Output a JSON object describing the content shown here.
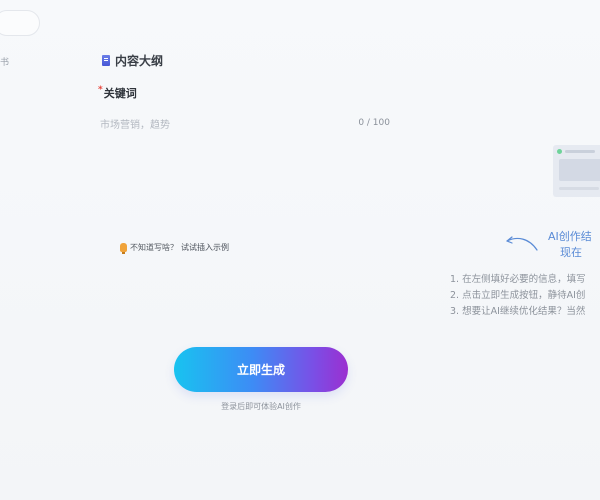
{
  "sidebar": {
    "partial_label": "书"
  },
  "section": {
    "title": "内容大纲",
    "icon": "document-icon"
  },
  "keyword": {
    "label": "关键词",
    "required_mark": "*",
    "placeholder": "市场营销，趋势",
    "counter": "0 / 100"
  },
  "hint": {
    "icon": "lightbulb-icon",
    "prefix": "不知道写啥？",
    "link": "试试插入示例"
  },
  "generate": {
    "label": "立即生成",
    "tip": "登录后即可体验AI创作"
  },
  "guide": {
    "title_line1": "AI创作结",
    "title_line2": "现在",
    "steps": [
      "1. 在左侧填好必要的信息，填写",
      "2. 点击立即生成按钮，静待AI创",
      "3. 想要让AI继续优化结果？当然"
    ]
  },
  "colors": {
    "button_start": "#18c3f0",
    "button_end": "#9b2fd0",
    "required": "#e8463c",
    "accent_blue": "#5a8bd6"
  }
}
